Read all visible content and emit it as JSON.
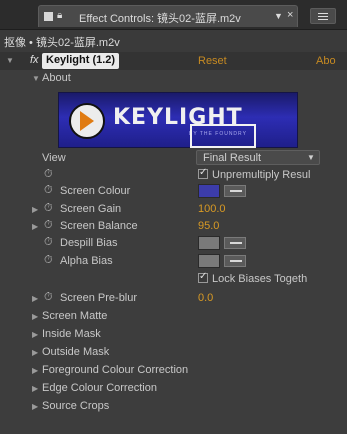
{
  "panel": {
    "tab_title": "Effect Controls: 镜头02-蓝屏.m2v",
    "tab_dropdown_icon": "chevron-down-icon",
    "tab_close": "×",
    "source_line": "抠像 • 镜头02-蓝屏.m2v"
  },
  "effect": {
    "fx_badge": "fx",
    "name": "Keylight (1.2)",
    "reset_label": "Reset",
    "about_link": "Abo",
    "about_section": "About",
    "logo_text": "KEYLIGHT",
    "logo_sub": "BY THE FOUNDRY"
  },
  "params": {
    "view_label": "View",
    "view_value": "Final Result",
    "unpremultiply_label": "Unpremultiply Resul",
    "screen_colour_label": "Screen Colour",
    "screen_colour_value": "#3c3caa",
    "screen_gain_label": "Screen Gain",
    "screen_gain_value": "100.0",
    "screen_balance_label": "Screen Balance",
    "screen_balance_value": "95.0",
    "despill_bias_label": "Despill Bias",
    "despill_bias_color": "#7a7a7a",
    "alpha_bias_label": "Alpha Bias",
    "alpha_bias_color": "#7a7a7a",
    "lock_biases_label": "Lock Biases Togeth",
    "screen_preblur_label": "Screen Pre-blur",
    "screen_preblur_value": "0.0"
  },
  "groups": [
    "Screen Matte",
    "Inside Mask",
    "Outside Mask",
    "Foreground Colour Correction",
    "Edge Colour Correction",
    "Source Crops"
  ],
  "colors": {
    "value_orange": "#d89a24",
    "highlight_box": "#f2f2f2"
  }
}
